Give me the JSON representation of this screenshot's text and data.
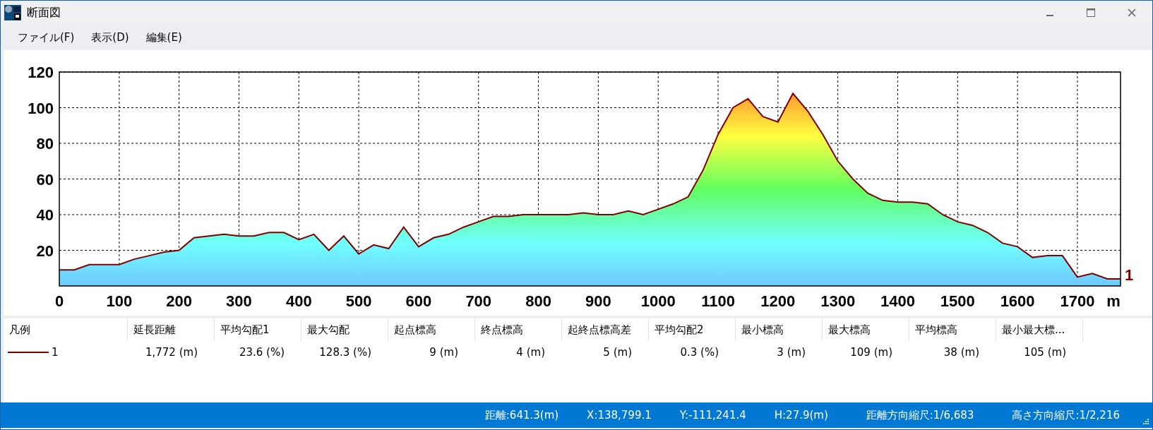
{
  "window": {
    "title": "断面図"
  },
  "menu": [
    "ファイル(F)",
    "表示(D)",
    "編集(E)"
  ],
  "chart_data": {
    "type": "area",
    "grid": true,
    "xlabel": "m",
    "xlim": [
      0,
      1772
    ],
    "ylim": [
      0,
      120
    ],
    "xticks": [
      0,
      100,
      200,
      300,
      400,
      500,
      600,
      700,
      800,
      900,
      1000,
      1100,
      1200,
      1300,
      1400,
      1500,
      1600,
      1700
    ],
    "yticks": [
      20,
      40,
      60,
      80,
      100,
      120
    ],
    "x": [
      0,
      25,
      50,
      75,
      100,
      125,
      150,
      175,
      200,
      225,
      250,
      275,
      300,
      325,
      350,
      375,
      400,
      425,
      450,
      475,
      500,
      525,
      550,
      575,
      600,
      625,
      650,
      675,
      700,
      725,
      750,
      775,
      800,
      825,
      850,
      875,
      900,
      925,
      950,
      975,
      1000,
      1025,
      1050,
      1075,
      1100,
      1125,
      1150,
      1175,
      1200,
      1225,
      1250,
      1275,
      1300,
      1325,
      1350,
      1375,
      1400,
      1425,
      1450,
      1475,
      1500,
      1525,
      1550,
      1575,
      1600,
      1625,
      1650,
      1675,
      1700,
      1725,
      1750,
      1772
    ],
    "series": [
      {
        "name": "1",
        "color": "#800000",
        "values": [
          9,
          9,
          12,
          12,
          12,
          15,
          17,
          19,
          20,
          27,
          28,
          29,
          28,
          28,
          30,
          30,
          26,
          29,
          20,
          28,
          18,
          23,
          21,
          33,
          22,
          27,
          29,
          33,
          36,
          39,
          39,
          40,
          40,
          40,
          40,
          41,
          40,
          40,
          42,
          40,
          43,
          46,
          50,
          65,
          85,
          100,
          105,
          95,
          92,
          108,
          98,
          85,
          70,
          60,
          52,
          48,
          47,
          47,
          46,
          40,
          36,
          34,
          30,
          24,
          22,
          16,
          17,
          17,
          5,
          7,
          4,
          4
        ]
      }
    ]
  },
  "table": {
    "columns": [
      "凡例",
      "延長距離",
      "平均勾配1",
      "最大勾配",
      "起点標高",
      "終点標高",
      "起終点標高差",
      "平均勾配2",
      "最小標高",
      "最大標高",
      "平均標高",
      "最小最大標..."
    ],
    "rows": [
      {
        "color": "#800000",
        "cells": [
          "1",
          "1,772 (m)",
          "23.6 (%)",
          "128.3 (%)",
          "9 (m)",
          "4 (m)",
          "5 (m)",
          "0.3 (%)",
          "3 (m)",
          "109 (m)",
          "38 (m)",
          "105 (m)"
        ]
      }
    ]
  },
  "status_bar": [
    "距離:641.3(m)",
    "X:138,799.1",
    "Y:-111,241.4",
    "H:27.9(m)",
    "距離方向縮尺:1/6,683",
    "高さ方向縮尺:1/2,216"
  ]
}
